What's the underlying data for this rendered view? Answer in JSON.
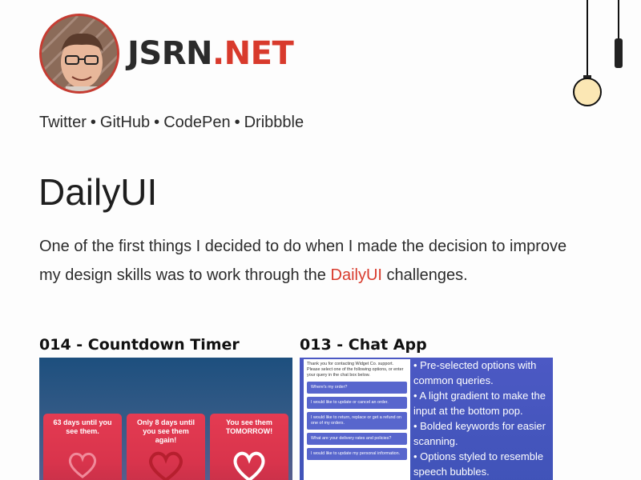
{
  "site": {
    "title_main": "JSRN",
    "title_accent": ".NET"
  },
  "social": {
    "links": [
      "Twitter",
      "GitHub",
      "CodePen",
      "Dribbble"
    ],
    "separator": "•"
  },
  "page": {
    "title": "DailyUI",
    "intro_before": "One of the first things I decided to do when I made the decision to improve my design skills was to work through the ",
    "intro_link": "DailyUI",
    "intro_after": " challenges."
  },
  "cards": [
    {
      "title": "014 - Countdown Timer",
      "tiles": [
        "63 days until you see them.",
        "Only 8 days until you see them again!",
        "You see them TOMORROW!"
      ]
    },
    {
      "title": "013 - Chat App",
      "chat_intro": "Thank you for contacting Widget Co. support. Please select one of the following options, or enter your query in the chat box below.",
      "chat_options": [
        "Where's my order?",
        "I would like to update or cancel an order.",
        "I would like to return, replace or get a refund on one of my orders.",
        "What are your delivery rates and policies?",
        "I would like to update my personal information."
      ],
      "bullets": [
        "• Pre-selected options with common queries.",
        "• A light gradient to make the input at the bottom pop.",
        "• Bolded keywords for easier scanning.",
        "• Options styled to resemble speech bubbles."
      ]
    }
  ],
  "colors": {
    "accent": "#d83a2c",
    "text": "#2b2b2b",
    "chat_bg": "#4c59c4",
    "timer_tile": "#e43b52"
  },
  "icons": {
    "lamp": "hanging-lightbulb-icon",
    "heart": "heart-outline-icon"
  }
}
